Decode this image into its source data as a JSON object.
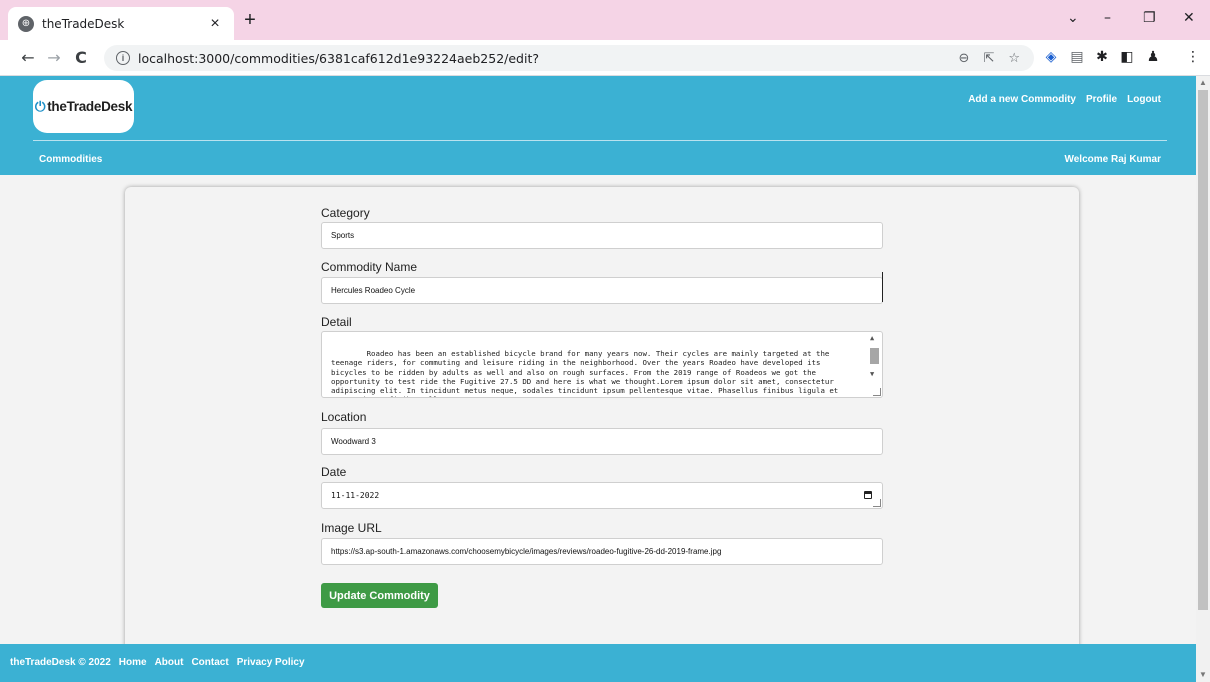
{
  "browser": {
    "tab_title": "theTradeDesk",
    "tab_close": "×",
    "new_tab": "+",
    "url": "localhost:3000/commodities/6381caf612d1e93224aeb252/edit?",
    "back": "←",
    "forward": "→",
    "reload": "C",
    "minimize": "–",
    "restore": "❐",
    "close": "✕",
    "dropdown": "⌄"
  },
  "header": {
    "logo_text": "theTradeDesk",
    "links": [
      "Add a new Commodity",
      "Profile",
      "Logout"
    ],
    "nav_left": "Commodities",
    "welcome": "Welcome Raj Kumar"
  },
  "form": {
    "category_label": "Category",
    "category_value": "Sports",
    "name_label": "Commodity Name",
    "name_value": "Hercules Roadeo Cycle",
    "detail_label": "Detail",
    "detail_value": "Roadeo has been an established bicycle brand for many years now. Their cycles are mainly targeted at the teenage riders, for commuting and leisure riding in the neighborhood. Over the years Roadeo have developed its bicycles to be ridden by adults as well and also on rough surfaces. From the 2019 range of Roadeos we got the opportunity to test ride the Fugitive 27.5 DD and here is what we thought.Lorem ipsum dolor sit amet, consectetur adipiscing elit. In tincidunt metus neque, sodales tincidunt ipsum pellentesque vitae. Phasellus finibus ligula et magna vitae, finibus ullamcorper",
    "location_label": "Location",
    "location_value": "Woodward 3",
    "date_label": "Date",
    "date_value": "11-11-2022",
    "image_label": "Image URL",
    "image_value": "https://s3.ap-south-1.amazonaws.com/choosemybicycle/images/reviews/roadeo-fugitive-26-dd-2019-frame.jpg",
    "submit_label": "Update Commodity"
  },
  "footer": {
    "copyright": "theTradeDesk © 2022",
    "links": [
      "Home",
      "About",
      "Contact",
      "Privacy Policy"
    ]
  },
  "colors": {
    "brand": "#3bb1d3",
    "submit": "#3e9a45",
    "tab_strip": "#f5d4e6"
  }
}
